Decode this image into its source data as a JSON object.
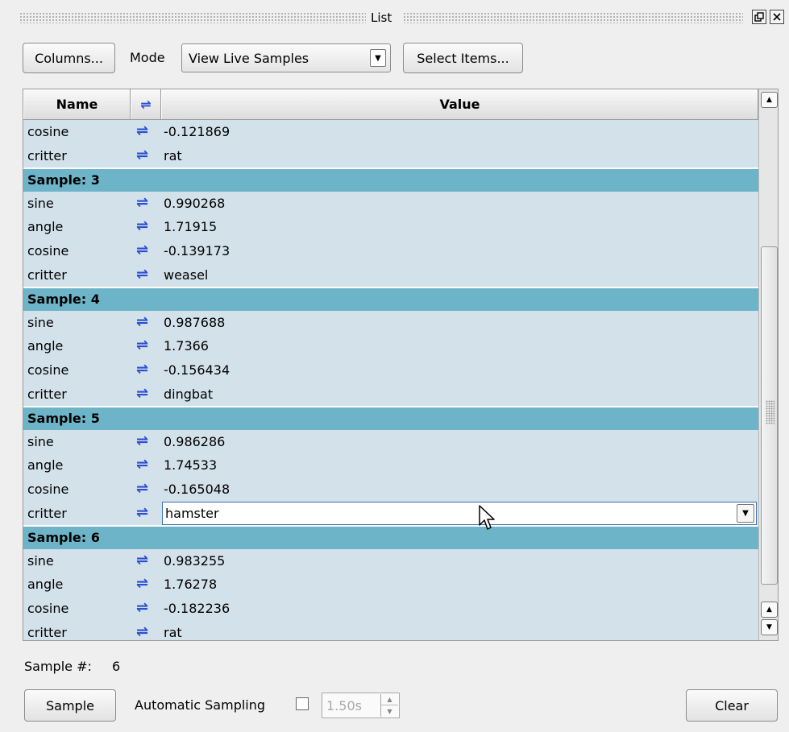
{
  "window": {
    "title": "List"
  },
  "toolbar": {
    "columns_label": "Columns...",
    "mode_label": "Mode",
    "mode_value": "View Live Samples",
    "select_items_label": "Select Items..."
  },
  "table": {
    "headers": {
      "name": "Name",
      "swap": "⇌",
      "value": "Value"
    },
    "swap_glyph": "⇌",
    "items": [
      {
        "kind": "row",
        "name": "cosine",
        "value": "-0.121869"
      },
      {
        "kind": "row",
        "name": "critter",
        "value": "rat"
      },
      {
        "kind": "group",
        "label": "Sample: 3"
      },
      {
        "kind": "row",
        "name": "sine",
        "value": "0.990268"
      },
      {
        "kind": "row",
        "name": "angle",
        "value": "1.71915"
      },
      {
        "kind": "row",
        "name": "cosine",
        "value": "-0.139173"
      },
      {
        "kind": "row",
        "name": "critter",
        "value": "weasel"
      },
      {
        "kind": "group",
        "label": "Sample: 4"
      },
      {
        "kind": "row",
        "name": "sine",
        "value": "0.987688"
      },
      {
        "kind": "row",
        "name": "angle",
        "value": "1.7366"
      },
      {
        "kind": "row",
        "name": "cosine",
        "value": "-0.156434"
      },
      {
        "kind": "row",
        "name": "critter",
        "value": "dingbat"
      },
      {
        "kind": "group",
        "label": "Sample: 5"
      },
      {
        "kind": "row",
        "name": "sine",
        "value": "0.986286"
      },
      {
        "kind": "row",
        "name": "angle",
        "value": "1.74533"
      },
      {
        "kind": "row",
        "name": "cosine",
        "value": "-0.165048"
      },
      {
        "kind": "row",
        "name": "critter",
        "value": "hamster",
        "editing": true
      },
      {
        "kind": "group",
        "label": "Sample: 6"
      },
      {
        "kind": "row",
        "name": "sine",
        "value": "0.983255"
      },
      {
        "kind": "row",
        "name": "angle",
        "value": "1.76278"
      },
      {
        "kind": "row",
        "name": "cosine",
        "value": "-0.182236"
      },
      {
        "kind": "row",
        "name": "critter",
        "value": "rat"
      }
    ]
  },
  "status": {
    "sample_label": "Sample #:",
    "sample_value": "6"
  },
  "bottom": {
    "sample_button": "Sample",
    "auto_sampling_label": "Automatic Sampling",
    "auto_sampling_checked": false,
    "interval_value": "1.50s",
    "clear_button": "Clear"
  }
}
